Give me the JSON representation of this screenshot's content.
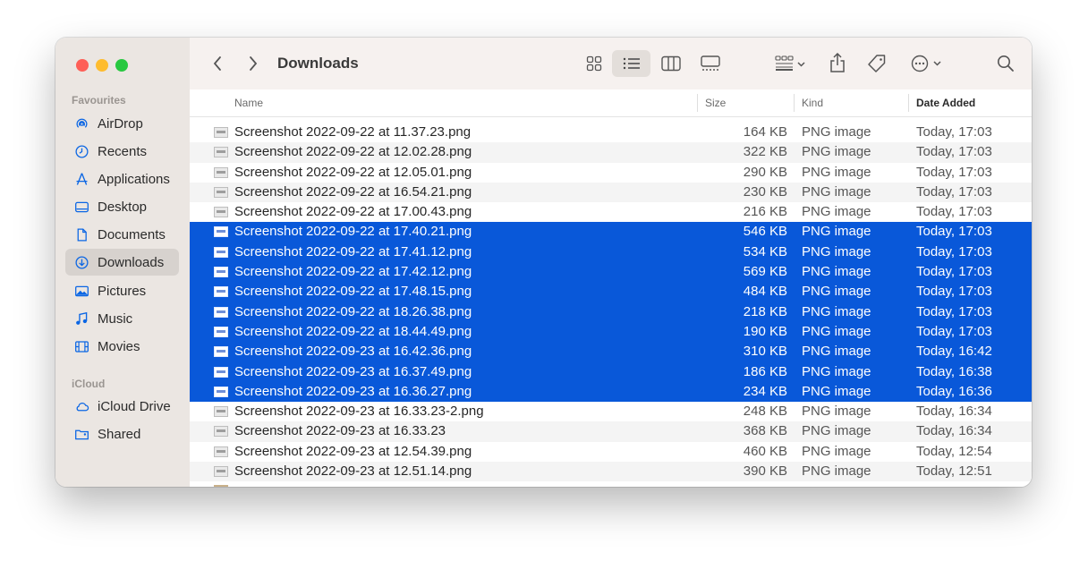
{
  "window": {
    "title": "Downloads",
    "traffic_lights": [
      "close",
      "minimize",
      "zoom"
    ]
  },
  "sidebar": {
    "favourites_heading": "Favourites",
    "favourites": [
      {
        "label": "AirDrop",
        "icon": "airdrop-icon"
      },
      {
        "label": "Recents",
        "icon": "clock-icon"
      },
      {
        "label": "Applications",
        "icon": "applications-icon"
      },
      {
        "label": "Desktop",
        "icon": "desktop-icon"
      },
      {
        "label": "Documents",
        "icon": "document-icon"
      },
      {
        "label": "Downloads",
        "icon": "download-icon",
        "active": true
      },
      {
        "label": "Pictures",
        "icon": "pictures-icon"
      },
      {
        "label": "Music",
        "icon": "music-note-icon"
      },
      {
        "label": "Movies",
        "icon": "film-icon"
      }
    ],
    "icloud_heading": "iCloud",
    "icloud": [
      {
        "label": "iCloud Drive",
        "icon": "cloud-icon"
      },
      {
        "label": "Shared",
        "icon": "shared-folder-icon"
      }
    ]
  },
  "toolbar": {
    "back_icon": "chevron-left-icon",
    "forward_icon": "chevron-right-icon",
    "title": "Downloads",
    "views": [
      "icon-view",
      "list-view",
      "column-view",
      "gallery-view"
    ],
    "active_view": "list-view"
  },
  "columns": {
    "name": "Name",
    "size": "Size",
    "kind": "Kind",
    "date_added": "Date Added"
  },
  "files": [
    {
      "name": "Screenshot 2022-09-22 at 11.37.23.png",
      "size": "164 KB",
      "kind": "PNG image",
      "date": "Today, 17:03",
      "selected": false
    },
    {
      "name": "Screenshot 2022-09-22 at 12.02.28.png",
      "size": "322 KB",
      "kind": "PNG image",
      "date": "Today, 17:03",
      "selected": false
    },
    {
      "name": "Screenshot 2022-09-22 at 12.05.01.png",
      "size": "290 KB",
      "kind": "PNG image",
      "date": "Today, 17:03",
      "selected": false
    },
    {
      "name": "Screenshot 2022-09-22 at 16.54.21.png",
      "size": "230 KB",
      "kind": "PNG image",
      "date": "Today, 17:03",
      "selected": false
    },
    {
      "name": "Screenshot 2022-09-22 at 17.00.43.png",
      "size": "216 KB",
      "kind": "PNG image",
      "date": "Today, 17:03",
      "selected": false
    },
    {
      "name": "Screenshot 2022-09-22 at 17.40.21.png",
      "size": "546 KB",
      "kind": "PNG image",
      "date": "Today, 17:03",
      "selected": true
    },
    {
      "name": "Screenshot 2022-09-22 at 17.41.12.png",
      "size": "534 KB",
      "kind": "PNG image",
      "date": "Today, 17:03",
      "selected": true
    },
    {
      "name": "Screenshot 2022-09-22 at 17.42.12.png",
      "size": "569 KB",
      "kind": "PNG image",
      "date": "Today, 17:03",
      "selected": true
    },
    {
      "name": "Screenshot 2022-09-22 at 17.48.15.png",
      "size": "484 KB",
      "kind": "PNG image",
      "date": "Today, 17:03",
      "selected": true
    },
    {
      "name": "Screenshot 2022-09-22 at 18.26.38.png",
      "size": "218 KB",
      "kind": "PNG image",
      "date": "Today, 17:03",
      "selected": true
    },
    {
      "name": "Screenshot 2022-09-22 at 18.44.49.png",
      "size": "190 KB",
      "kind": "PNG image",
      "date": "Today, 17:03",
      "selected": true
    },
    {
      "name": "Screenshot 2022-09-23 at 16.42.36.png",
      "size": "310 KB",
      "kind": "PNG image",
      "date": "Today, 16:42",
      "selected": true
    },
    {
      "name": "Screenshot 2022-09-23 at 16.37.49.png",
      "size": "186 KB",
      "kind": "PNG image",
      "date": "Today, 16:38",
      "selected": true
    },
    {
      "name": "Screenshot 2022-09-23 at 16.36.27.png",
      "size": "234 KB",
      "kind": "PNG image",
      "date": "Today, 16:36",
      "selected": true
    },
    {
      "name": "Screenshot 2022-09-23 at 16.33.23-2.png",
      "size": "248 KB",
      "kind": "PNG image",
      "date": "Today, 16:34",
      "selected": false
    },
    {
      "name": "Screenshot 2022-09-23 at 16.33.23",
      "size": "368 KB",
      "kind": "PNG image",
      "date": "Today, 16:34",
      "selected": false
    },
    {
      "name": "Screenshot 2022-09-23 at 12.54.39.png",
      "size": "460 KB",
      "kind": "PNG image",
      "date": "Today, 12:54",
      "selected": false
    },
    {
      "name": "Screenshot 2022-09-23 at 12.51.14.png",
      "size": "390 KB",
      "kind": "PNG image",
      "date": "Today, 12:51",
      "selected": false
    }
  ],
  "colors": {
    "selection": "#0958d9",
    "sidebar_bg": "#ebe6e2",
    "toolbar_bg": "#f6f1ef",
    "row_alt": "#f4f4f4"
  }
}
